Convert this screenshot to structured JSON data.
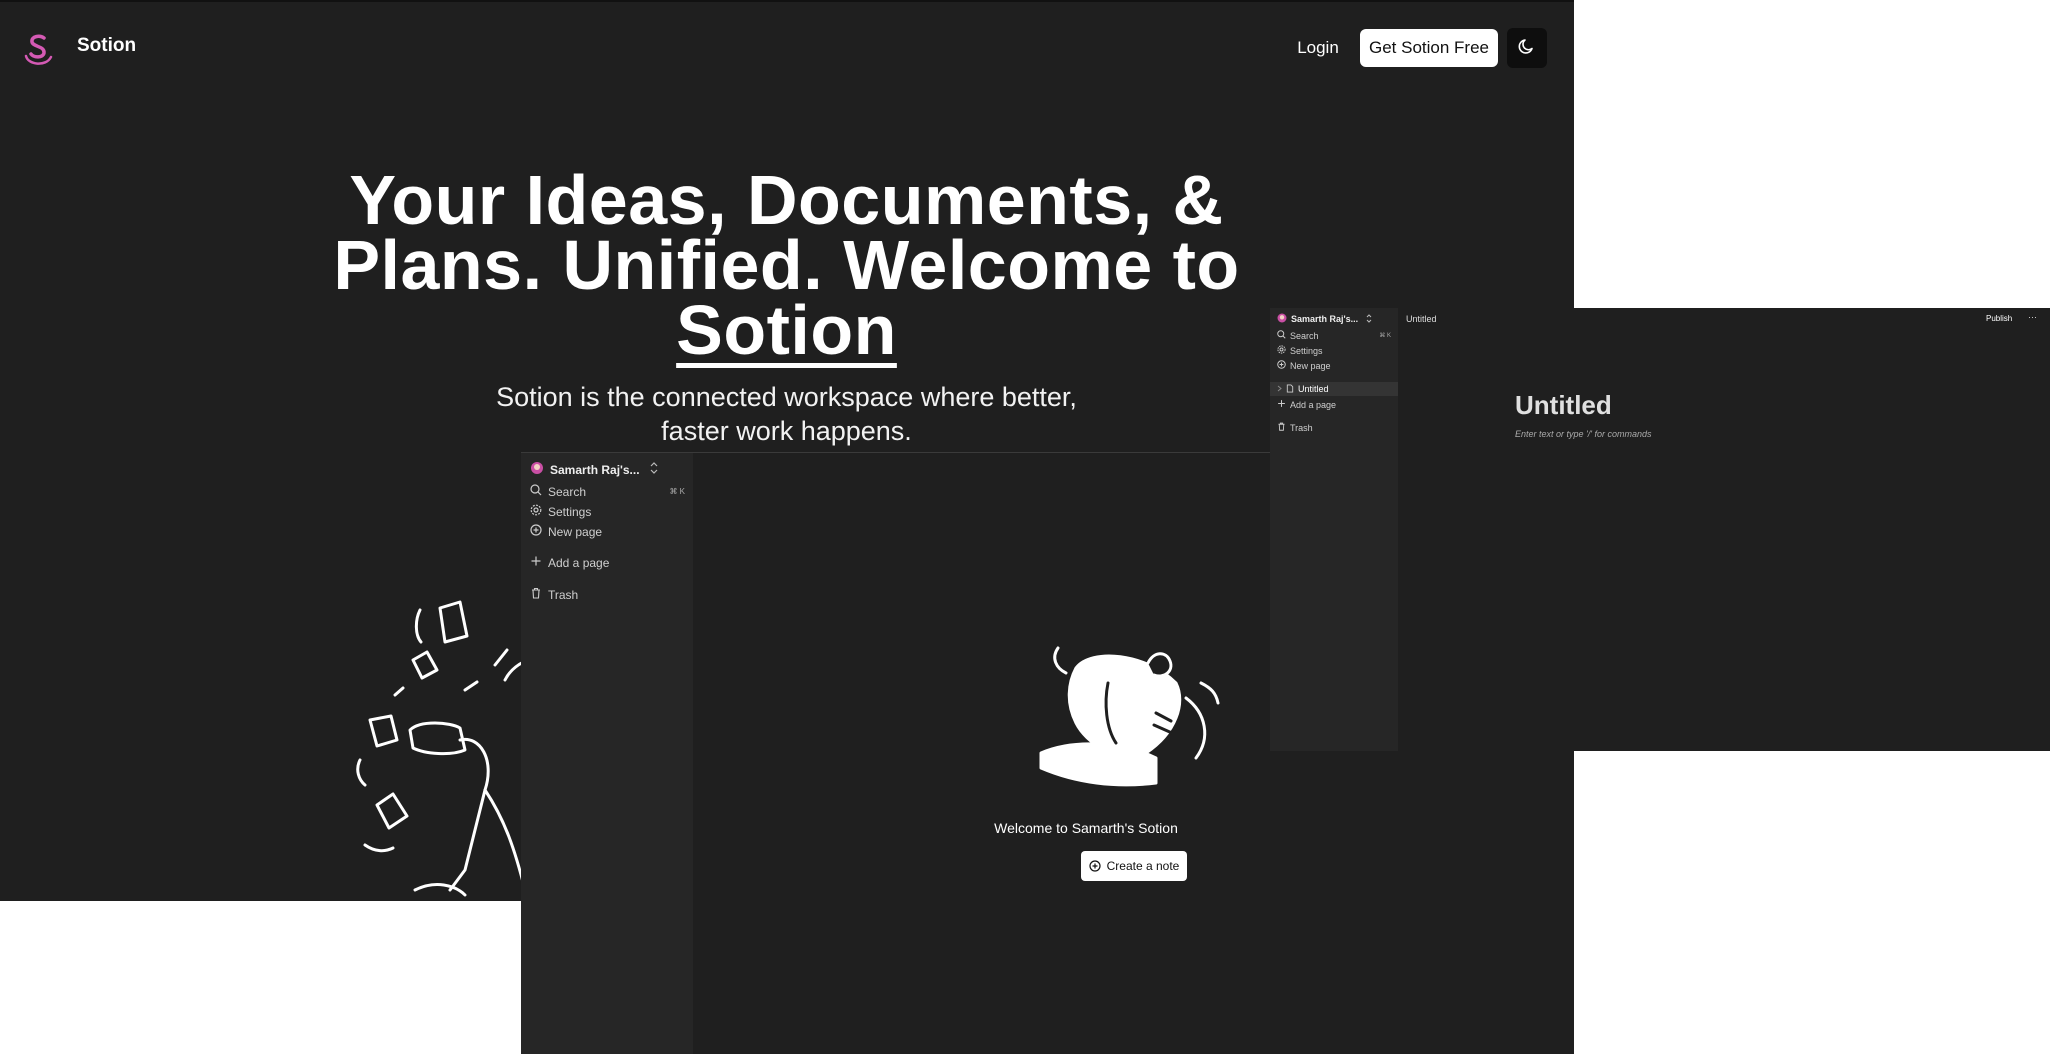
{
  "landing": {
    "brand": "Sotion",
    "login_label": "Login",
    "cta_label": "Get Sotion Free",
    "hero_lead": "Your Ideas, Documents, & Plans. Unified. Welcome to",
    "hero_brand": "Sotion",
    "subtitle": "Sotion is the connected workspace where better, faster work happens."
  },
  "app_main": {
    "workspace_name": "Samarth Raj's...",
    "nav": {
      "search": "Search",
      "search_shortcut": "⌘ K",
      "settings": "Settings",
      "new_page": "New page",
      "add_page": "Add a page",
      "trash": "Trash"
    },
    "welcome_text": "Welcome to Samarth's Sotion",
    "create_label": "Create a note"
  },
  "app_doc": {
    "workspace_name": "Samarth Raj's...",
    "nav": {
      "search": "Search",
      "search_shortcut": "⌘ K",
      "settings": "Settings",
      "new_page": "New page",
      "page_item": "Untitled",
      "add_page": "Add a page",
      "trash": "Trash"
    },
    "breadcrumb": "Untitled",
    "publish_label": "Publish",
    "more_label": "···",
    "doc_title": "Untitled",
    "doc_placeholder": "Enter text or type '/' for commands"
  },
  "colors": {
    "background": "#1f1f1f",
    "sidebar": "#262626",
    "brand_accent": "#d45ab4"
  },
  "icons": [
    "sotion-logo",
    "moon-icon",
    "search-icon",
    "gear-icon",
    "plus-circle-icon",
    "plus-icon",
    "trash-icon",
    "chevron-updown-icon",
    "file-icon",
    "chevron-right-icon"
  ]
}
